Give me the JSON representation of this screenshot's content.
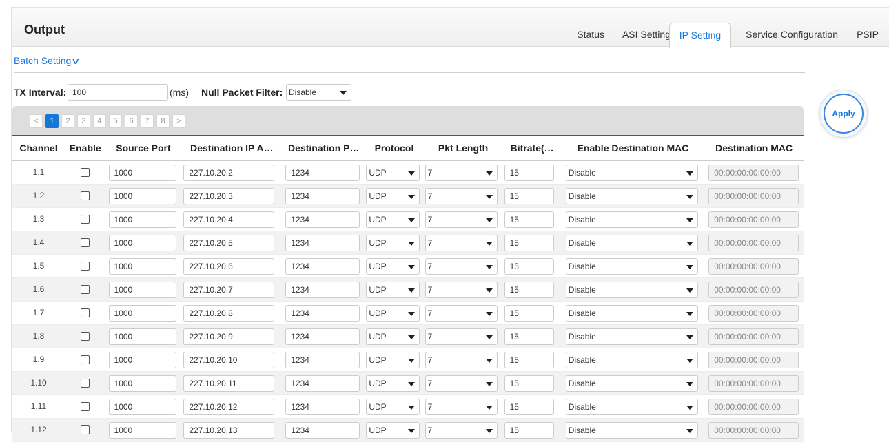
{
  "header": {
    "title": "Output",
    "tabs": [
      {
        "label": "Status"
      },
      {
        "label": "ASI Setting"
      },
      {
        "label": "IP Setting",
        "active": true
      },
      {
        "label": "Service Configuration"
      },
      {
        "label": "PSIP"
      }
    ]
  },
  "batch": {
    "label": "Batch Setting",
    "icon": "chevron-down-icon"
  },
  "tx": {
    "label": "TX Interval:",
    "value": "100",
    "unit": "(ms)",
    "null_filter_label": "Null Packet Filter:",
    "null_filter_value": "Disable"
  },
  "pager": {
    "prev": "<",
    "next": ">",
    "pages": [
      "1",
      "2",
      "3",
      "4",
      "5",
      "6",
      "7",
      "8"
    ],
    "active_page": "1"
  },
  "apply_label": "Apply",
  "table": {
    "columns": [
      "Channel",
      "Enable",
      "Source Port",
      "Destination IP A…",
      "Destination P…",
      "Protocol",
      "Pkt Length",
      "Bitrate(…",
      "Enable Destination MAC",
      "Destination MAC"
    ],
    "rows": [
      {
        "channel": "1.1",
        "source_port": "1000",
        "dest_ip": "227.10.20.2",
        "dest_port": "1234",
        "protocol": "UDP",
        "pkt_length": "7",
        "bitrate": "15",
        "enable_mac": "Disable",
        "dest_mac": "00:00:00:00:00:00"
      },
      {
        "channel": "1.2",
        "source_port": "1000",
        "dest_ip": "227.10.20.3",
        "dest_port": "1234",
        "protocol": "UDP",
        "pkt_length": "7",
        "bitrate": "15",
        "enable_mac": "Disable",
        "dest_mac": "00:00:00:00:00:00"
      },
      {
        "channel": "1.3",
        "source_port": "1000",
        "dest_ip": "227.10.20.4",
        "dest_port": "1234",
        "protocol": "UDP",
        "pkt_length": "7",
        "bitrate": "15",
        "enable_mac": "Disable",
        "dest_mac": "00:00:00:00:00:00"
      },
      {
        "channel": "1.4",
        "source_port": "1000",
        "dest_ip": "227.10.20.5",
        "dest_port": "1234",
        "protocol": "UDP",
        "pkt_length": "7",
        "bitrate": "15",
        "enable_mac": "Disable",
        "dest_mac": "00:00:00:00:00:00"
      },
      {
        "channel": "1.5",
        "source_port": "1000",
        "dest_ip": "227.10.20.6",
        "dest_port": "1234",
        "protocol": "UDP",
        "pkt_length": "7",
        "bitrate": "15",
        "enable_mac": "Disable",
        "dest_mac": "00:00:00:00:00:00"
      },
      {
        "channel": "1.6",
        "source_port": "1000",
        "dest_ip": "227.10.20.7",
        "dest_port": "1234",
        "protocol": "UDP",
        "pkt_length": "7",
        "bitrate": "15",
        "enable_mac": "Disable",
        "dest_mac": "00:00:00:00:00:00"
      },
      {
        "channel": "1.7",
        "source_port": "1000",
        "dest_ip": "227.10.20.8",
        "dest_port": "1234",
        "protocol": "UDP",
        "pkt_length": "7",
        "bitrate": "15",
        "enable_mac": "Disable",
        "dest_mac": "00:00:00:00:00:00"
      },
      {
        "channel": "1.8",
        "source_port": "1000",
        "dest_ip": "227.10.20.9",
        "dest_port": "1234",
        "protocol": "UDP",
        "pkt_length": "7",
        "bitrate": "15",
        "enable_mac": "Disable",
        "dest_mac": "00:00:00:00:00:00"
      },
      {
        "channel": "1.9",
        "source_port": "1000",
        "dest_ip": "227.10.20.10",
        "dest_port": "1234",
        "protocol": "UDP",
        "pkt_length": "7",
        "bitrate": "15",
        "enable_mac": "Disable",
        "dest_mac": "00:00:00:00:00:00"
      },
      {
        "channel": "1.10",
        "source_port": "1000",
        "dest_ip": "227.10.20.11",
        "dest_port": "1234",
        "protocol": "UDP",
        "pkt_length": "7",
        "bitrate": "15",
        "enable_mac": "Disable",
        "dest_mac": "00:00:00:00:00:00"
      },
      {
        "channel": "1.11",
        "source_port": "1000",
        "dest_ip": "227.10.20.12",
        "dest_port": "1234",
        "protocol": "UDP",
        "pkt_length": "7",
        "bitrate": "15",
        "enable_mac": "Disable",
        "dest_mac": "00:00:00:00:00:00"
      },
      {
        "channel": "1.12",
        "source_port": "1000",
        "dest_ip": "227.10.20.13",
        "dest_port": "1234",
        "protocol": "UDP",
        "pkt_length": "7",
        "bitrate": "15",
        "enable_mac": "Disable",
        "dest_mac": "00:00:00:00:00:00"
      }
    ]
  },
  "colors": {
    "accent": "#1677d9",
    "header_bg": "#f0f0f0",
    "pager_bg": "#dedede",
    "stripe": "#f2f2f2"
  }
}
